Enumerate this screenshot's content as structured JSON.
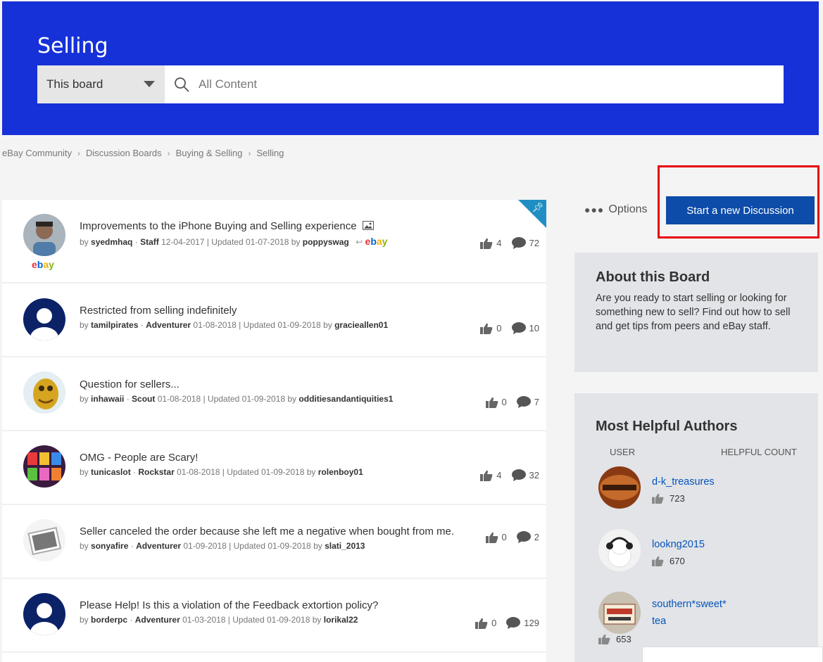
{
  "header": {
    "title": "Selling",
    "scope_label": "This board",
    "search_placeholder": "All Content"
  },
  "breadcrumb": [
    "eBay Community",
    "Discussion Boards",
    "Buying & Selling",
    "Selling"
  ],
  "actions": {
    "options_label": "Options",
    "start_label": "Start a new Discussion"
  },
  "threads": [
    {
      "title": "Improvements to the iPhone Buying and Selling experience",
      "author": "syedmhaq",
      "rank": "Staff",
      "date": "12-04-2017",
      "updated": "01-07-2018",
      "last_by": "poppyswag",
      "kudos": "4",
      "replies": "72",
      "avatar_icon": "person-photo-icon",
      "badge": "ebay"
    },
    {
      "title": "Restricted from selling indefinitely",
      "author": "tamilpirates",
      "rank": "Adventurer",
      "date": "01-08-2018",
      "updated": "01-09-2018",
      "last_by": "gracieallen01",
      "kudos": "0",
      "replies": "10",
      "avatar_icon": "default-avatar-icon"
    },
    {
      "title": "Question for sellers...",
      "author": "inhawaii",
      "rank": "Scout",
      "date": "01-08-2018",
      "updated": "01-09-2018",
      "last_by": "odditiesandantiquities1",
      "kudos": "0",
      "replies": "7",
      "avatar_icon": "creature-avatar-icon"
    },
    {
      "title": "OMG - People are Scary!",
      "author": "tunicaslot",
      "rank": "Rockstar",
      "date": "01-08-2018",
      "updated": "01-09-2018",
      "last_by": "rolenboy01",
      "kudos": "4",
      "replies": "32",
      "avatar_icon": "slot-machine-avatar-icon"
    },
    {
      "title": "Seller canceled the order because she left me a negative when bought from me.",
      "author": "sonyafire",
      "rank": "Adventurer",
      "date": "01-09-2018",
      "updated": "01-09-2018",
      "last_by": "slati_2013",
      "kudos": "0",
      "replies": "2",
      "avatar_icon": "photo-placeholder-icon"
    },
    {
      "title": "Please Help! Is this a violation of the Feedback extortion policy?",
      "author": "borderpc",
      "rank": "Adventurer",
      "date": "01-03-2018",
      "updated": "01-09-2018",
      "last_by": "lorikal22",
      "kudos": "0",
      "replies": "129",
      "avatar_icon": "default-avatar-icon"
    }
  ],
  "labels": {
    "by": "by",
    "updated": "Updated",
    "ebay_badge": "ebay"
  },
  "about": {
    "title": "About this Board",
    "text": "Are you ready to start selling or looking for something new to sell? Find out how to sell and get tips from peers and eBay staff."
  },
  "helpful": {
    "title": "Most Helpful Authors",
    "col_user": "USER",
    "col_count": "HELPFUL COUNT",
    "authors": [
      {
        "name": "d-k_treasures",
        "count": "723"
      },
      {
        "name": "lookng2015",
        "count": "670"
      },
      {
        "name": "southern*sweet*",
        "name2": "tea",
        "count": "653"
      }
    ]
  },
  "colors": {
    "hero": "#1631d8",
    "button": "#0d4ca8",
    "highlight": "#e8000f",
    "link": "#0654ba"
  }
}
